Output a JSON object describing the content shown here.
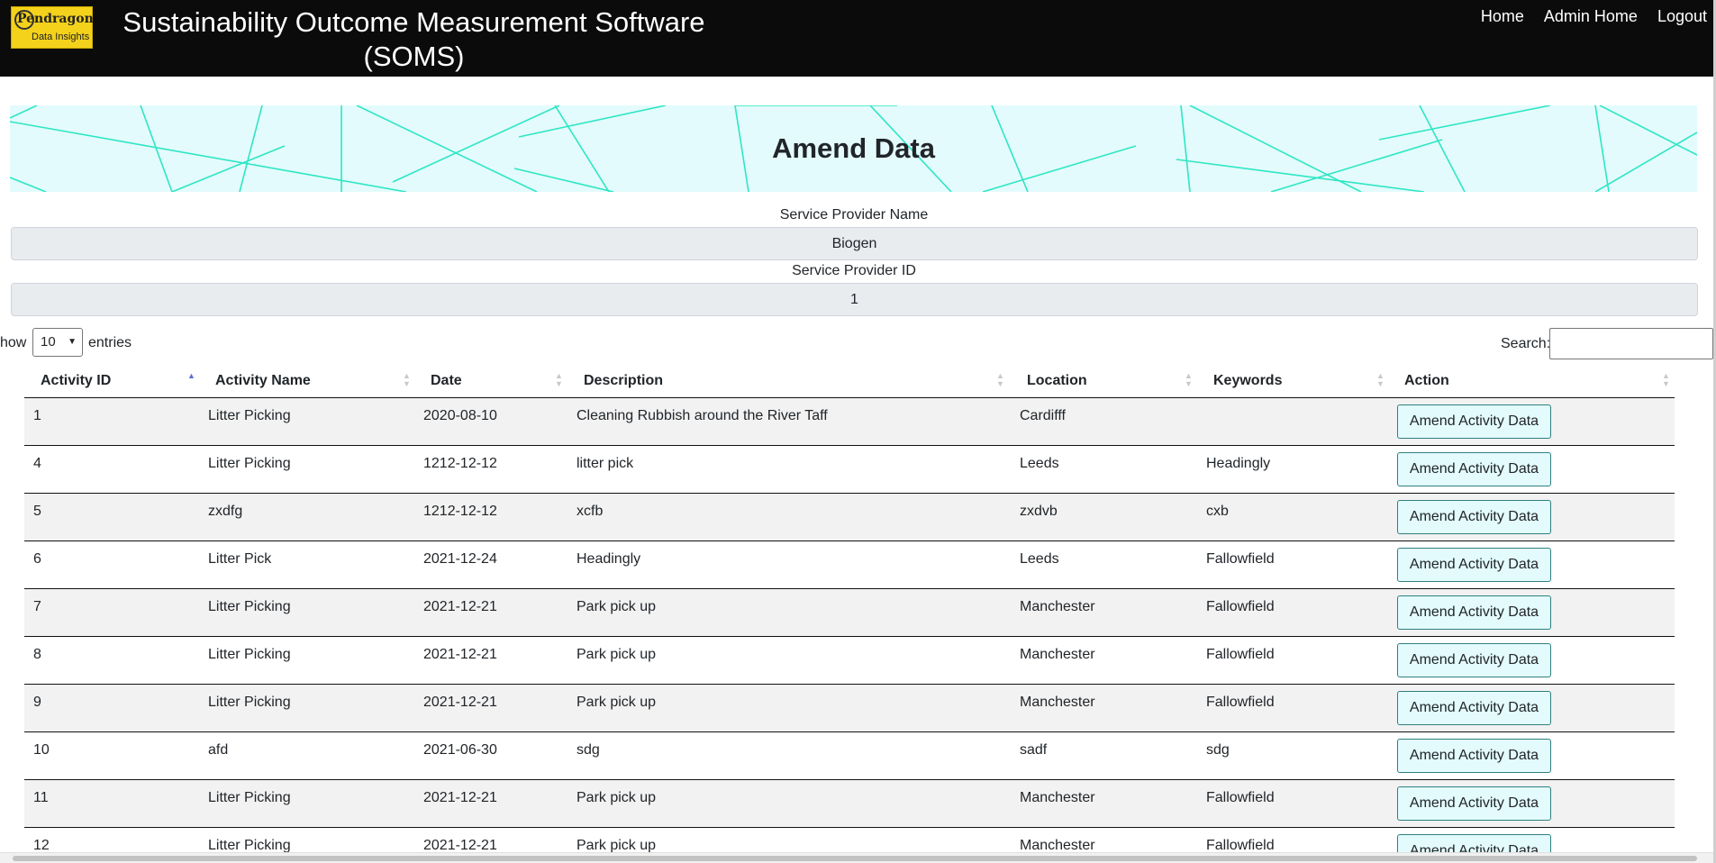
{
  "header": {
    "logo_text_1": "Pendragon",
    "logo_text_2": "Data Insights",
    "title_line1": "Sustainability Outcome Measurement Software",
    "title_line2": "(SOMS)",
    "nav": [
      {
        "label": "Home"
      },
      {
        "label": "Admin Home"
      },
      {
        "label": "Logout"
      }
    ]
  },
  "banner": {
    "title": "Amend Data"
  },
  "form": {
    "provider_name_label": "Service Provider Name",
    "provider_name_value": "Biogen",
    "provider_id_label": "Service Provider ID",
    "provider_id_value": "1"
  },
  "controls": {
    "show_label": "how",
    "page_size": "10",
    "entries_label": "entries",
    "search_label": "Search:",
    "search_value": ""
  },
  "table": {
    "columns": [
      "Activity ID",
      "Activity Name",
      "Date",
      "Description",
      "Location",
      "Keywords",
      "Action"
    ],
    "sorted_column": "Activity ID",
    "sort_direction": "ascending",
    "rows": [
      {
        "id": "1",
        "name": "Litter Picking",
        "date": "2020-08-10",
        "description": "Cleaning Rubbish around the River Taff",
        "location": "Cardifff",
        "keywords": "",
        "action": "Amend Activity Data"
      },
      {
        "id": "4",
        "name": "Litter Picking",
        "date": "1212-12-12",
        "description": "litter pick",
        "location": "Leeds",
        "keywords": "Headingly",
        "action": "Amend Activity Data"
      },
      {
        "id": "5",
        "name": "zxdfg",
        "date": "1212-12-12",
        "description": "xcfb",
        "location": "zxdvb",
        "keywords": "cxb",
        "action": "Amend Activity Data"
      },
      {
        "id": "6",
        "name": "Litter Pick",
        "date": "2021-12-24",
        "description": "Headingly",
        "location": "Leeds",
        "keywords": "Fallowfield",
        "action": "Amend Activity Data"
      },
      {
        "id": "7",
        "name": "Litter Picking",
        "date": "2021-12-21",
        "description": "Park pick up",
        "location": "Manchester",
        "keywords": "Fallowfield",
        "action": "Amend Activity Data"
      },
      {
        "id": "8",
        "name": "Litter Picking",
        "date": "2021-12-21",
        "description": "Park pick up",
        "location": "Manchester",
        "keywords": "Fallowfield",
        "action": "Amend Activity Data"
      },
      {
        "id": "9",
        "name": "Litter Picking",
        "date": "2021-12-21",
        "description": "Park pick up",
        "location": "Manchester",
        "keywords": "Fallowfield",
        "action": "Amend Activity Data"
      },
      {
        "id": "10",
        "name": "afd",
        "date": "2021-06-30",
        "description": "sdg",
        "location": "sadf",
        "keywords": "sdg",
        "action": "Amend Activity Data"
      },
      {
        "id": "11",
        "name": "Litter Picking",
        "date": "2021-12-21",
        "description": "Park pick up",
        "location": "Manchester",
        "keywords": "Fallowfield",
        "action": "Amend Activity Data"
      },
      {
        "id": "12",
        "name": "Litter Picking",
        "date": "2021-12-21",
        "description": "Park pick up",
        "location": "Manchester",
        "keywords": "Fallowfield",
        "action": "Amend Activity Data"
      }
    ]
  },
  "colors": {
    "header_bg": "#0b0b0b",
    "banner_bg": "#e3fbfc",
    "banner_lines": "#2ee6c4",
    "button_bg": "#e3fbfc",
    "logo_bg": "#f4d21c"
  }
}
